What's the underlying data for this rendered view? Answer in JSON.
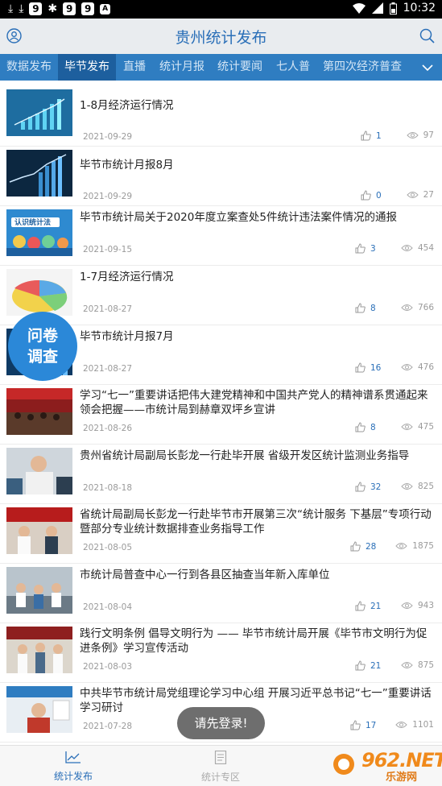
{
  "status_bar": {
    "time": "10:32",
    "notif_badges": [
      "9",
      "9",
      "9"
    ],
    "a_badge": "A"
  },
  "header": {
    "title": "贵州统计发布"
  },
  "tabs": [
    "数据发布",
    "毕节发布",
    "直播",
    "统计月报",
    "统计要闻",
    "七人普",
    "第四次经济普查"
  ],
  "active_tab": "毕节发布",
  "articles": [
    {
      "title": "1-8月经济运行情况",
      "date": "2021-09-29",
      "likes": "1",
      "views": "97"
    },
    {
      "title": "毕节市统计月报8月",
      "date": "2021-09-29",
      "likes": "0",
      "views": "27"
    },
    {
      "title": "毕节市统计局关于2020年度立案查处5件统计违法案件情况的通报",
      "date": "2021-09-15",
      "likes": "3",
      "views": "454",
      "thumb_text": "认识统计法"
    },
    {
      "title": "1-7月经济运行情况",
      "date": "2021-08-27",
      "likes": "8",
      "views": "766"
    },
    {
      "title": "毕节市统计月报7月",
      "date": "2021-08-27",
      "likes": "16",
      "views": "476"
    },
    {
      "title": "学习“七一”重要讲话把伟大建党精神和中国共产党人的精神谱系贯通起来领会把握——市统计局到赫章双坪乡宣讲",
      "date": "2021-08-26",
      "likes": "8",
      "views": "475"
    },
    {
      "title": "贵州省统计局副局长彭龙一行赴毕开展 省级开发区统计监测业务指导",
      "date": "2021-08-18",
      "likes": "32",
      "views": "825"
    },
    {
      "title": "省统计局副局长彭龙一行赴毕节市开展第三次“统计服务 下基层”专项行动暨部分专业统计数据排查业务指导工作",
      "date": "2021-08-05",
      "likes": "28",
      "views": "1875"
    },
    {
      "title": "市统计局普查中心一行到各县区抽查当年新入库单位",
      "date": "2021-08-04",
      "likes": "21",
      "views": "943"
    },
    {
      "title": "践行文明条例 倡导文明行为 —— 毕节市统计局开展《毕节市文明行为促进条例》学习宣传活动",
      "date": "2021-08-03",
      "likes": "21",
      "views": "875"
    },
    {
      "title": "中共毕节市统计局党组理论学习中心组 开展习近平总书记“七一”重要讲话 学习研讨",
      "date": "2021-07-28",
      "likes": "17",
      "views": "1101"
    }
  ],
  "survey_button": {
    "line1": "问卷",
    "line2": "调查"
  },
  "toast": "请先登录!",
  "bottom_nav": [
    {
      "label": "统计发布",
      "active": true
    },
    {
      "label": "统计专区",
      "active": false
    }
  ],
  "watermark": {
    "number": "962.NET",
    "site": "乐游网"
  },
  "colors": {
    "accent": "#2f7dc1",
    "title_blue": "#2a6fb8",
    "survey": "#2b88d8",
    "watermark": "#f08a1c"
  }
}
